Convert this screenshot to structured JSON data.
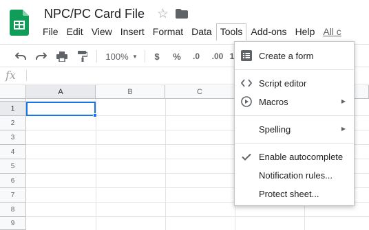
{
  "header": {
    "doc_title": "NPC/PC Card File",
    "app_icon": "sheets-logo-icon"
  },
  "menubar": {
    "items": [
      "File",
      "Edit",
      "View",
      "Insert",
      "Format",
      "Data",
      "Tools",
      "Add-ons",
      "Help"
    ],
    "active": "Tools",
    "changes_link": "All c"
  },
  "toolbar": {
    "zoom": "100%",
    "currency": "$",
    "percent": "%",
    "decrease_decimals": ".0",
    "increase_decimals": ".00",
    "more_formats": "1"
  },
  "formula_bar": {
    "fx_label": "fx"
  },
  "grid": {
    "columns": [
      "A",
      "B",
      "C"
    ],
    "rows": [
      "1",
      "2",
      "3",
      "4",
      "5",
      "6",
      "7",
      "8",
      "9"
    ],
    "active_cell": "A1"
  },
  "tools_menu": {
    "items": [
      {
        "label": "Create a form",
        "icon": "form-icon"
      },
      {
        "label": "Script editor",
        "icon": "code-icon"
      },
      {
        "label": "Macros",
        "icon": "play-circle-icon",
        "submenu": true
      },
      {
        "label": "Spelling",
        "icon": "",
        "submenu": true
      },
      {
        "label": "Enable autocomplete",
        "icon": "checkmark-icon",
        "checked": true
      },
      {
        "label": "Notification rules...",
        "icon": ""
      },
      {
        "label": "Protect sheet...",
        "icon": ""
      }
    ]
  },
  "colors": {
    "accent": "#1a73e8",
    "sheets_green": "#0f9d58"
  }
}
